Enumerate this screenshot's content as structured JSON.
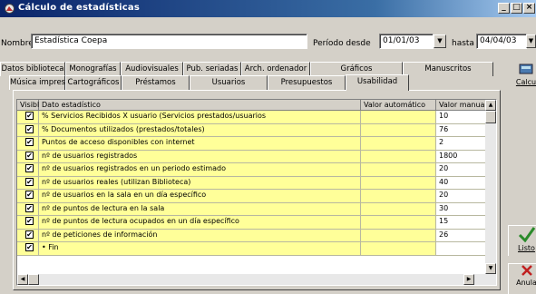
{
  "window": {
    "title": "Cálculo de estadísticas"
  },
  "form": {
    "nombre_label": "Nombre",
    "nombre_value": "Estadística Coepa",
    "periodo_label": "Período desde",
    "desde_value": "01/01/03",
    "hasta_label": "hasta",
    "hasta_value": "04/04/03"
  },
  "tabs_row1": [
    "Datos biblioteca",
    "Monografías",
    "Audiovisuales",
    "Pub. seriadas",
    "Arch. ordenador",
    "Gráficos",
    "Manuscritos"
  ],
  "tabs_row2": [
    "Música impresa",
    "Cartográficos",
    "Préstamos",
    "Usuarios",
    "Presupuestos",
    "Usabilidad"
  ],
  "active_tab": "Usabilidad",
  "table": {
    "headers": [
      "Visible",
      "Dato estadístico",
      "Valor automático",
      "Valor manual"
    ],
    "rows": [
      {
        "visible": true,
        "dato": "% Servicios Recibidos X usuario (Servicios prestados/usuarios",
        "auto": "",
        "manual": "10"
      },
      {
        "visible": true,
        "dato": "% Documentos utilizados (prestados/totales)",
        "auto": "",
        "manual": "76"
      },
      {
        "visible": true,
        "dato": "Puntos de acceso disponibles con internet",
        "auto": "",
        "manual": "2"
      },
      {
        "visible": true,
        "dato": "nº de usuarios registrados",
        "auto": "",
        "manual": "1800"
      },
      {
        "visible": true,
        "dato": "nº de usuarios registrados en un periodo estimado",
        "auto": "",
        "manual": "20"
      },
      {
        "visible": true,
        "dato": "nº de usuarios reales (utilizan Biblioteca)",
        "auto": "",
        "manual": "40"
      },
      {
        "visible": true,
        "dato": "nº de usuarios en la sala en un día específico",
        "auto": "",
        "manual": "20"
      },
      {
        "visible": true,
        "dato": "nº de puntos de lectura en la sala",
        "auto": "",
        "manual": "30"
      },
      {
        "visible": true,
        "dato": "nº de puntos de lectura ocupados en un día específico",
        "auto": "",
        "manual": "15"
      },
      {
        "visible": true,
        "dato": "nº de peticiones de información",
        "auto": "",
        "manual": "26"
      },
      {
        "visible": true,
        "dato": "• Fin",
        "auto": "",
        "manual": ""
      }
    ]
  },
  "side": {
    "top_label": "Calcu",
    "listo_label": "Listo",
    "anular_label": "Anula"
  }
}
